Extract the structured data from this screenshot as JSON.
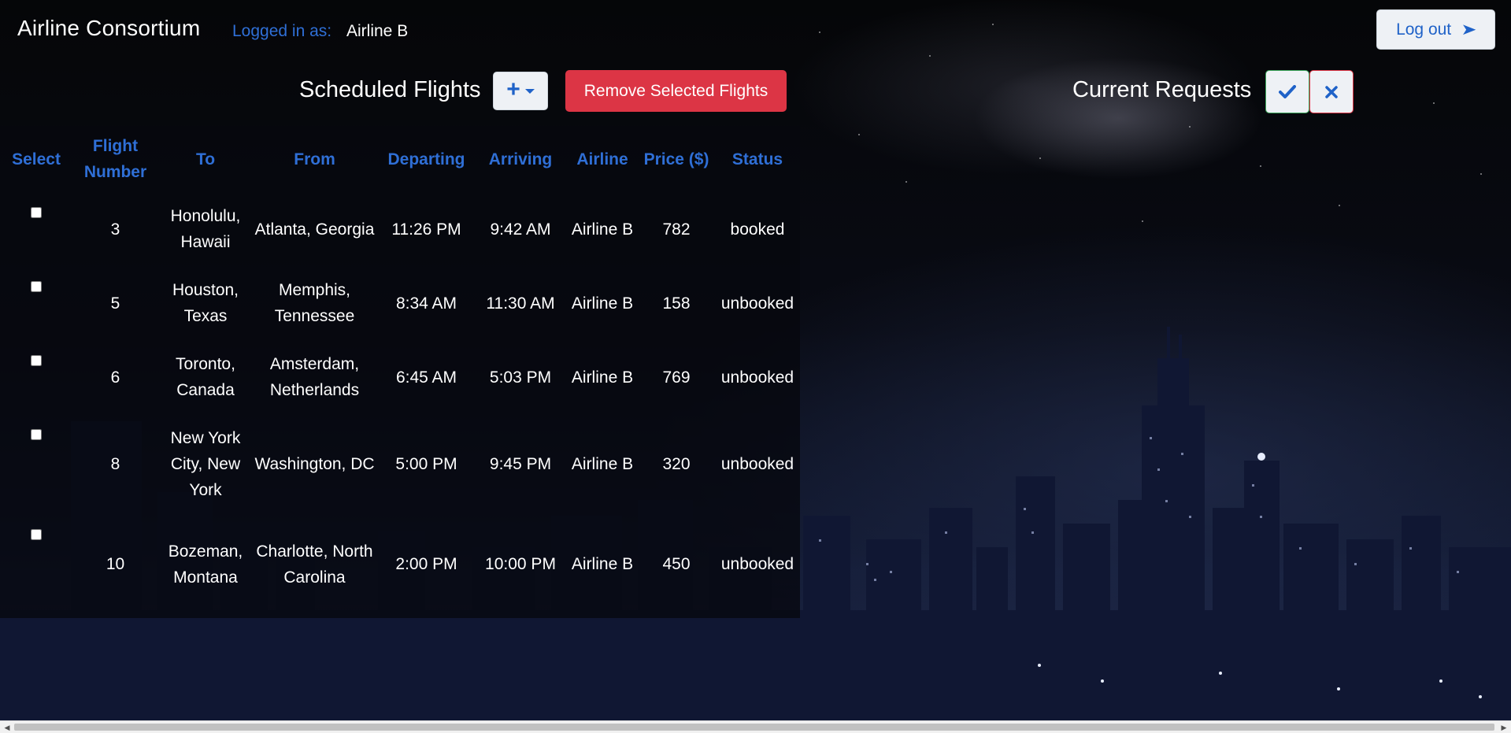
{
  "header": {
    "app_title": "Airline Consortium",
    "logged_in_label": "Logged in as:",
    "logged_in_user": "Airline B",
    "logout_label": "Log out",
    "logout_icon": "arrow-right-icon"
  },
  "scheduled": {
    "title": "Scheduled Flights",
    "add_icon": "plus-icon",
    "add_dropdown_icon": "caret-down-icon",
    "remove_label": "Remove Selected Flights"
  },
  "requests": {
    "title": "Current Requests",
    "accept_icon": "check-icon",
    "reject_icon": "close-icon"
  },
  "table": {
    "columns": [
      "Select",
      "Flight Number",
      "To",
      "From",
      "Departing",
      "Arriving",
      "Airline",
      "Price ($)",
      "Status"
    ],
    "rows": [
      {
        "selected": false,
        "flight_number": "3",
        "to": "Honolulu, Hawaii",
        "from": "Atlanta, Georgia",
        "departing": "11:26 PM",
        "arriving": "9:42 AM",
        "airline": "Airline B",
        "price": "782",
        "status": "booked"
      },
      {
        "selected": false,
        "flight_number": "5",
        "to": "Houston, Texas",
        "from": "Memphis, Tennessee",
        "departing": "8:34 AM",
        "arriving": "11:30 AM",
        "airline": "Airline B",
        "price": "158",
        "status": "unbooked"
      },
      {
        "selected": false,
        "flight_number": "6",
        "to": "Toronto, Canada",
        "from": "Amsterdam, Netherlands",
        "departing": "6:45 AM",
        "arriving": "5:03 PM",
        "airline": "Airline B",
        "price": "769",
        "status": "unbooked"
      },
      {
        "selected": false,
        "flight_number": "8",
        "to": "New York City, New York",
        "from": "Washington, DC",
        "departing": "5:00 PM",
        "arriving": "9:45 PM",
        "airline": "Airline B",
        "price": "320",
        "status": "unbooked"
      },
      {
        "selected": false,
        "flight_number": "10",
        "to": "Bozeman, Montana",
        "from": "Charlotte, North Carolina",
        "departing": "2:00 PM",
        "arriving": "10:00 PM",
        "airline": "Airline B",
        "price": "450",
        "status": "unbooked"
      }
    ]
  },
  "colors": {
    "accent_blue": "#2f6fd6",
    "danger_red": "#dc3545",
    "success_green": "#3aa55a"
  }
}
